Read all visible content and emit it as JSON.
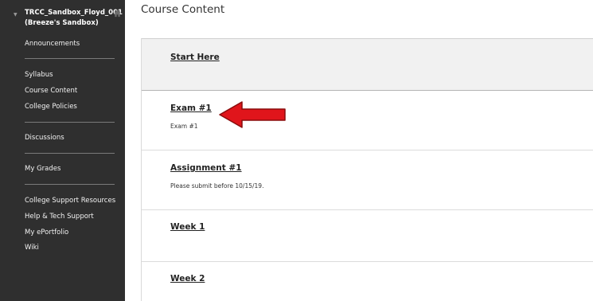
{
  "sidebar": {
    "course_title_line1": "TRCC_Sandbox_Floyd_001",
    "course_title_line2": "(Breeze's Sandbox)",
    "items": [
      {
        "label": "Announcements"
      },
      {
        "label": "Syllabus"
      },
      {
        "label": "Course Content"
      },
      {
        "label": "College Policies"
      },
      {
        "label": "Discussions"
      },
      {
        "label": "My Grades"
      },
      {
        "label": "College Support Resources"
      },
      {
        "label": "Help & Tech Support"
      },
      {
        "label": "My ePortfolio"
      },
      {
        "label": "Wiki"
      }
    ]
  },
  "main": {
    "page_title": "Course Content",
    "items": [
      {
        "title": "Start Here",
        "description": ""
      },
      {
        "title": "Exam #1",
        "description": "Exam #1"
      },
      {
        "title": "Assignment #1",
        "description": "Please submit before 10/15/19."
      },
      {
        "title": "Week 1",
        "description": ""
      },
      {
        "title": "Week 2",
        "description": ""
      }
    ]
  },
  "annotation": {
    "arrow_color": "#e0151b",
    "arrow_outline": "#8a0c0c"
  },
  "colors": {
    "sidebar_bg": "#2f2f2f",
    "highlight_row_bg": "#f1f1f1"
  }
}
